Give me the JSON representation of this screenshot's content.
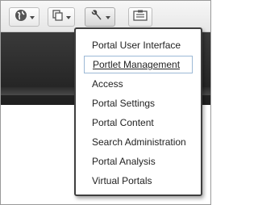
{
  "toolbar": {
    "buttons": [
      {
        "icon": "globe-icon",
        "has_caret": true
      },
      {
        "icon": "pages-icon",
        "has_caret": true
      },
      {
        "icon": "wrench-icon",
        "has_caret": true,
        "active": true
      },
      {
        "icon": "id-card-icon",
        "has_caret": false
      }
    ]
  },
  "menu": {
    "items": [
      {
        "label": "Portal User Interface"
      },
      {
        "label": "Portlet Management",
        "highlighted": true
      },
      {
        "label": "Access"
      },
      {
        "label": "Portal Settings"
      },
      {
        "label": "Portal Content"
      },
      {
        "label": "Search Administration"
      },
      {
        "label": "Portal Analysis"
      },
      {
        "label": "Virtual Portals"
      }
    ]
  },
  "colors": {
    "dark_band": "#2a2a2a",
    "menu_border": "#3f3f3f",
    "highlight_border": "#9cb9d6"
  }
}
